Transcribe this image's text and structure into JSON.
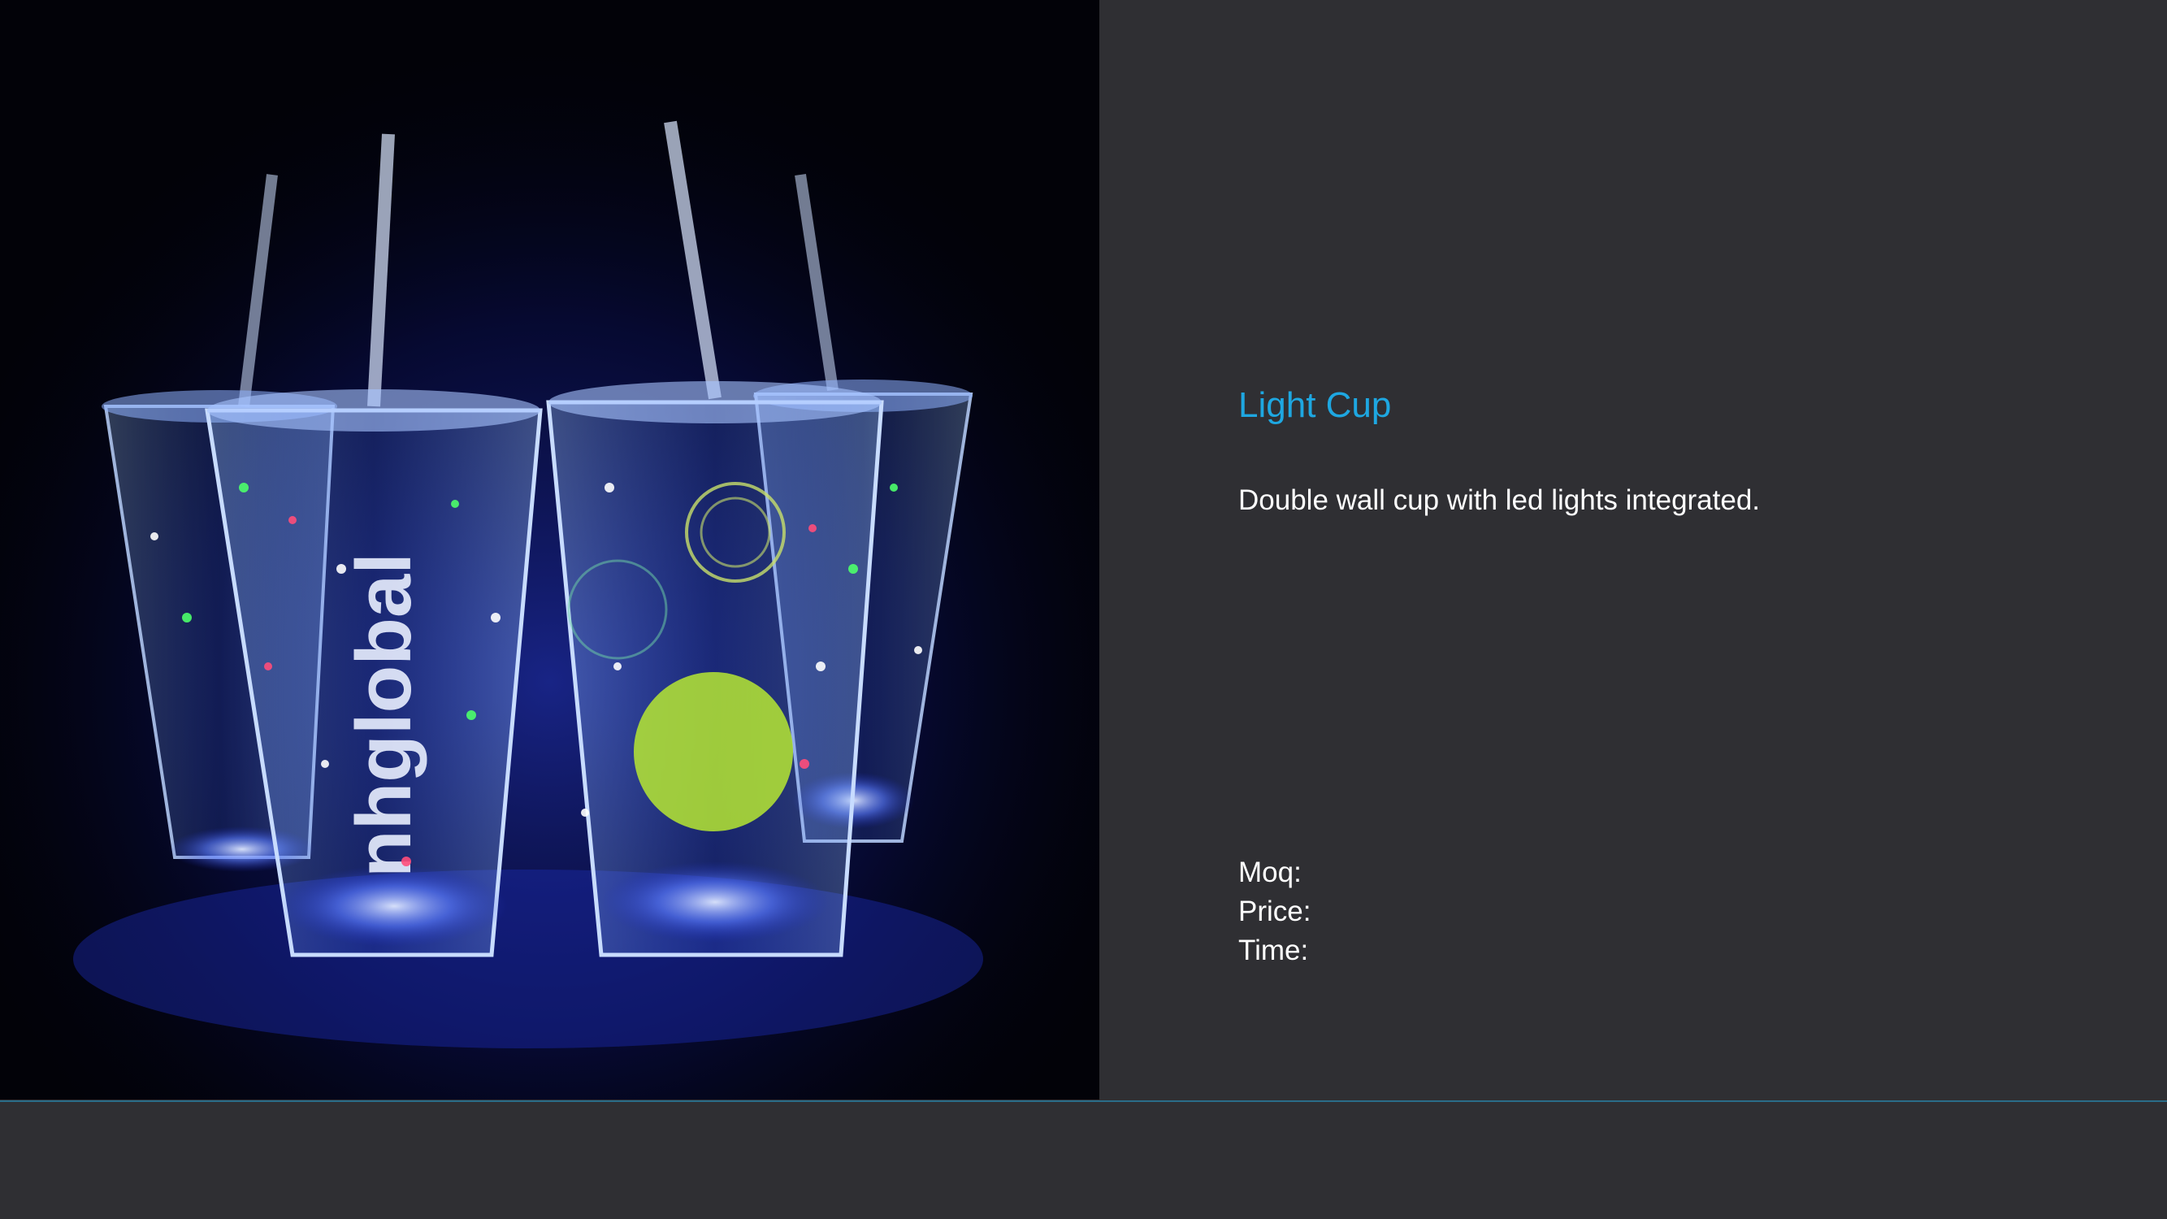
{
  "slide": {
    "title": "Light Cup",
    "description": "Double wall cup with led lights integrated.",
    "specs": [
      {
        "label": "Moq:"
      },
      {
        "label": "Price:"
      },
      {
        "label": "Time:"
      }
    ]
  },
  "photo": {
    "subject": "led-light-cups",
    "brand_mark": "nhglobal"
  },
  "colors": {
    "background": "#2f2f33",
    "title": "#1ea7e1",
    "text": "#ffffff",
    "divider": "#2a6d89"
  }
}
